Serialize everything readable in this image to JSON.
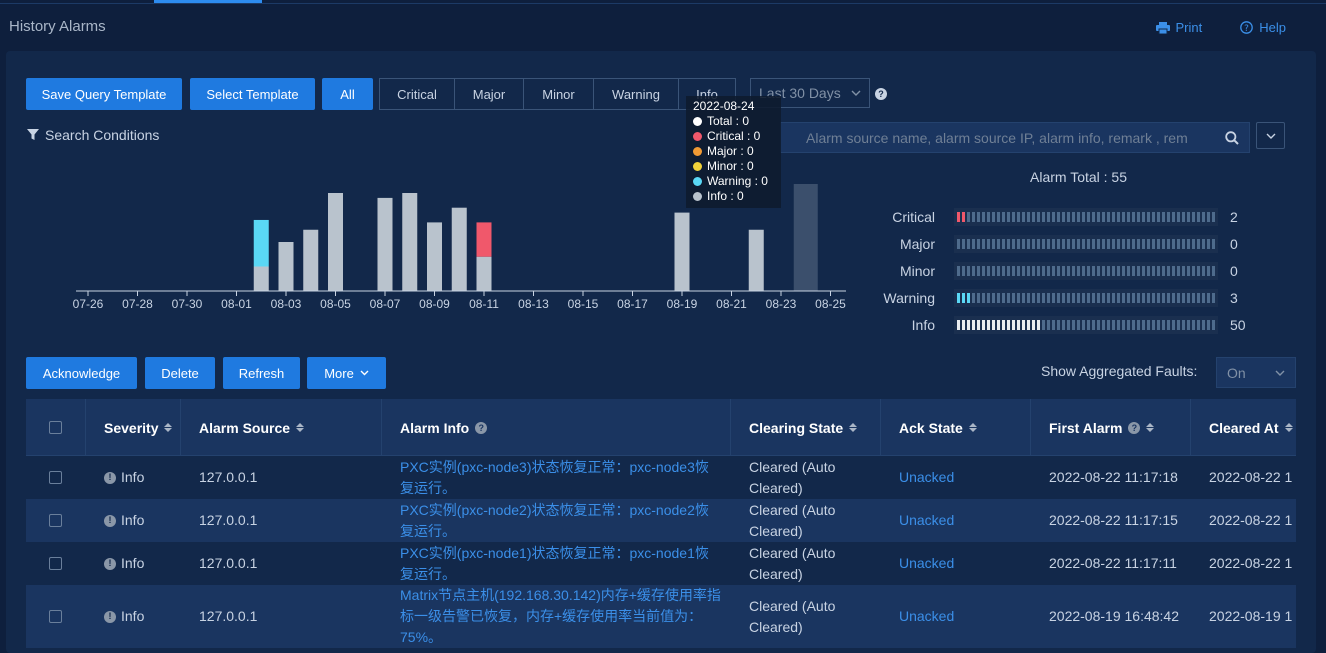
{
  "header": {
    "title": "History Alarms",
    "print_label": "Print",
    "help_label": "Help"
  },
  "toolbar": {
    "save_template": "Save Query Template",
    "select_template": "Select Template",
    "all": "All",
    "severities": [
      "Critical",
      "Major",
      "Minor",
      "Warning",
      "Info"
    ],
    "range": "Last 30 Days"
  },
  "search": {
    "conditions_label": "Search Conditions",
    "placeholder": "Alarm source name, alarm source IP, alarm info, remark , rem"
  },
  "colors": {
    "accent": "#1f7ae0",
    "critical": "#f0586b",
    "major": "#f09a34",
    "minor": "#f0d23a",
    "warning": "#5ad8f5",
    "info": "#b9c3cd"
  },
  "chart_data": {
    "type": "bar",
    "stacked": true,
    "categories": [
      "07-26",
      "07-27",
      "07-28",
      "07-29",
      "07-30",
      "07-31",
      "08-01",
      "08-02",
      "08-03",
      "08-04",
      "08-05",
      "08-06",
      "08-07",
      "08-08",
      "08-09",
      "08-10",
      "08-11",
      "08-12",
      "08-13",
      "08-14",
      "08-15",
      "08-16",
      "08-17",
      "08-18",
      "08-19",
      "08-20",
      "08-21",
      "08-22",
      "08-23",
      "08-24",
      "08-25"
    ],
    "tick_labels": [
      "07-26",
      "07-28",
      "07-30",
      "08-01",
      "08-03",
      "08-05",
      "08-07",
      "08-09",
      "08-11",
      "08-13",
      "08-15",
      "08-17",
      "08-19",
      "08-21",
      "08-23",
      "08-25"
    ],
    "series": [
      {
        "name": "Info",
        "color": "#b9c3cd",
        "values": [
          0,
          0,
          0,
          0,
          0,
          0,
          0,
          1,
          2,
          2.5,
          4,
          0,
          3.8,
          4,
          2.8,
          3.4,
          1.4,
          0,
          0,
          0,
          0,
          0,
          0,
          0,
          3.2,
          0,
          0,
          2.5,
          0,
          0,
          0
        ]
      },
      {
        "name": "Warning",
        "color": "#5ad8f5",
        "values": [
          0,
          0,
          0,
          0,
          0,
          0,
          0,
          1.9,
          0,
          0,
          0,
          0,
          0,
          0,
          0,
          0,
          0,
          0,
          0,
          0,
          0,
          0,
          0,
          0,
          0,
          0,
          0,
          0,
          0,
          0,
          0
        ]
      },
      {
        "name": "Critical",
        "color": "#f0586b",
        "values": [
          0,
          0,
          0,
          0,
          0,
          0,
          0,
          0,
          0,
          0,
          0,
          0,
          0,
          0,
          0,
          0,
          1.4,
          0,
          0,
          0,
          0,
          0,
          0,
          0,
          0,
          0,
          0,
          0,
          0,
          0,
          0
        ]
      }
    ],
    "highlight_category": "08-24",
    "grid": false,
    "legend": "none"
  },
  "tooltip": {
    "date": "2022-08-24",
    "rows": [
      {
        "label": "Total : 0",
        "color": "#ffffff"
      },
      {
        "label": "Critical : 0",
        "color": "#f0586b"
      },
      {
        "label": "Major : 0",
        "color": "#f09a34"
      },
      {
        "label": "Minor : 0",
        "color": "#f0d23a"
      },
      {
        "label": "Warning : 0",
        "color": "#5ad8f5"
      },
      {
        "label": "Info : 0",
        "color": "#b9c3cd"
      }
    ]
  },
  "totals": {
    "title": "Alarm Total : 55",
    "rows": [
      {
        "label": "Critical",
        "count": "2",
        "fill": 0.04,
        "color": "#f0586b"
      },
      {
        "label": "Major",
        "count": "0",
        "fill": 0,
        "color": "#f09a34"
      },
      {
        "label": "Minor",
        "count": "0",
        "fill": 0,
        "color": "#f0d23a"
      },
      {
        "label": "Warning",
        "count": "3",
        "fill": 0.055,
        "color": "#5ad8f5"
      },
      {
        "label": "Info",
        "count": "50",
        "fill": 0.33,
        "color": "#e8ecf0"
      }
    ]
  },
  "actions": {
    "acknowledge": "Acknowledge",
    "delete": "Delete",
    "refresh": "Refresh",
    "more": "More",
    "agg_label": "Show Aggregated Faults:",
    "agg_value": "On"
  },
  "table": {
    "headers": {
      "severity": "Severity",
      "source": "Alarm Source",
      "info": "Alarm Info",
      "clearing": "Clearing State",
      "ack": "Ack State",
      "first": "First Alarm",
      "cleared": "Cleared At"
    },
    "rows": [
      {
        "severity": "Info",
        "source": "127.0.0.1",
        "info": "PXC实例(pxc-node3)状态恢复正常：pxc-node3恢复运行。",
        "clearing": "Cleared (Auto Cleared)",
        "ack": "Unacked",
        "first": "2022-08-22 11:17:18",
        "cleared": "2022-08-22 1"
      },
      {
        "severity": "Info",
        "source": "127.0.0.1",
        "info": "PXC实例(pxc-node2)状态恢复正常：pxc-node2恢复运行。",
        "clearing": "Cleared (Auto Cleared)",
        "ack": "Unacked",
        "first": "2022-08-22 11:17:15",
        "cleared": "2022-08-22 1"
      },
      {
        "severity": "Info",
        "source": "127.0.0.1",
        "info": "PXC实例(pxc-node1)状态恢复正常：pxc-node1恢复运行。",
        "clearing": "Cleared (Auto Cleared)",
        "ack": "Unacked",
        "first": "2022-08-22 11:17:11",
        "cleared": "2022-08-22 1"
      },
      {
        "severity": "Info",
        "source": "127.0.0.1",
        "info": "Matrix节点主机(192.168.30.142)内存+缓存使用率指标一级告警已恢复，内存+缓存使用率当前值为：75%。",
        "clearing": "Cleared (Auto Cleared)",
        "ack": "Unacked",
        "first": "2022-08-19 16:48:42",
        "cleared": "2022-08-19 1"
      }
    ]
  }
}
